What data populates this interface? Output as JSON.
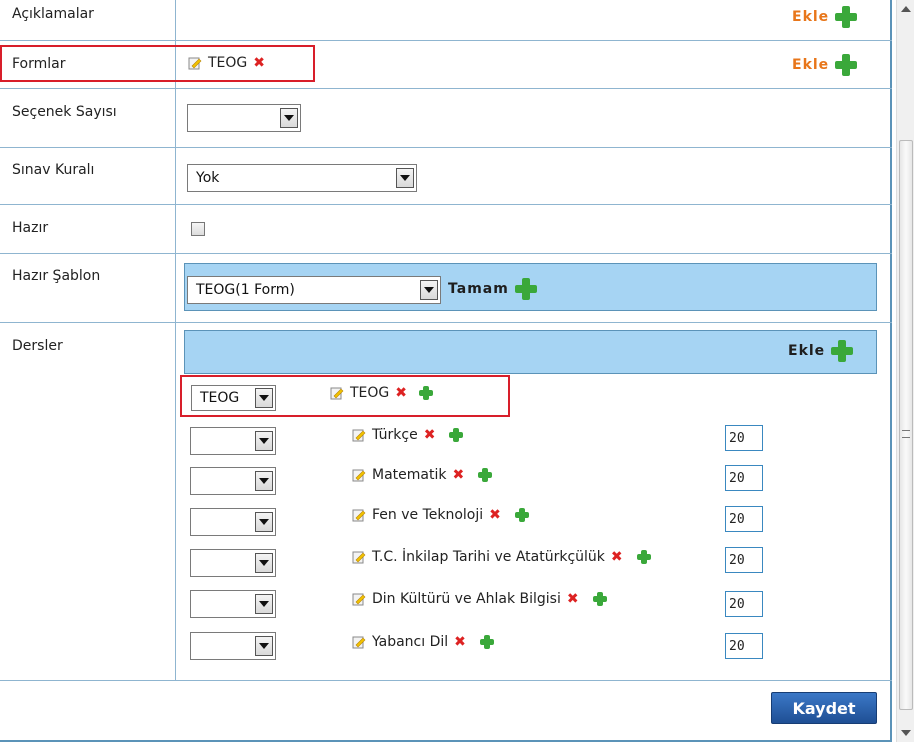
{
  "rows": {
    "aciklamalar": {
      "label": "Açıklamalar",
      "ekle": "Ekle"
    },
    "formlar": {
      "label": "Formlar",
      "tag": "TEOG",
      "ekle": "Ekle"
    },
    "secenek": {
      "label": "Seçenek Sayısı",
      "value": ""
    },
    "sinav": {
      "label": "Sınav Kuralı",
      "value": "Yok"
    },
    "hazir": {
      "label": "Hazır",
      "checked": false
    },
    "sablon": {
      "label": "Hazır Şablon",
      "value": "TEOG(1 Form)",
      "tamam": "Tamam"
    },
    "dersler": {
      "label": "Dersler",
      "ekle": "Ekle",
      "group_select": "TEOG",
      "group_name": "TEOG",
      "courses": [
        {
          "name": "Türkçe",
          "count": "20"
        },
        {
          "name": "Matematik",
          "count": "20"
        },
        {
          "name": "Fen ve Teknoloji",
          "count": "20"
        },
        {
          "name": "T.C. İnkilap Tarihi ve Atatürkçülük",
          "count": "20"
        },
        {
          "name": "Din Kültürü ve Ahlak Bilgisi",
          "count": "20"
        },
        {
          "name": "Yabancı Dil",
          "count": "20"
        }
      ]
    }
  },
  "save_button": "Kaydet",
  "colors": {
    "accent_orange": "#e8761a",
    "bar_blue": "#a6d4f3",
    "border_blue": "#5b93b8",
    "highlight_red": "#d81e2a",
    "button_blue": "#2b5fab"
  }
}
